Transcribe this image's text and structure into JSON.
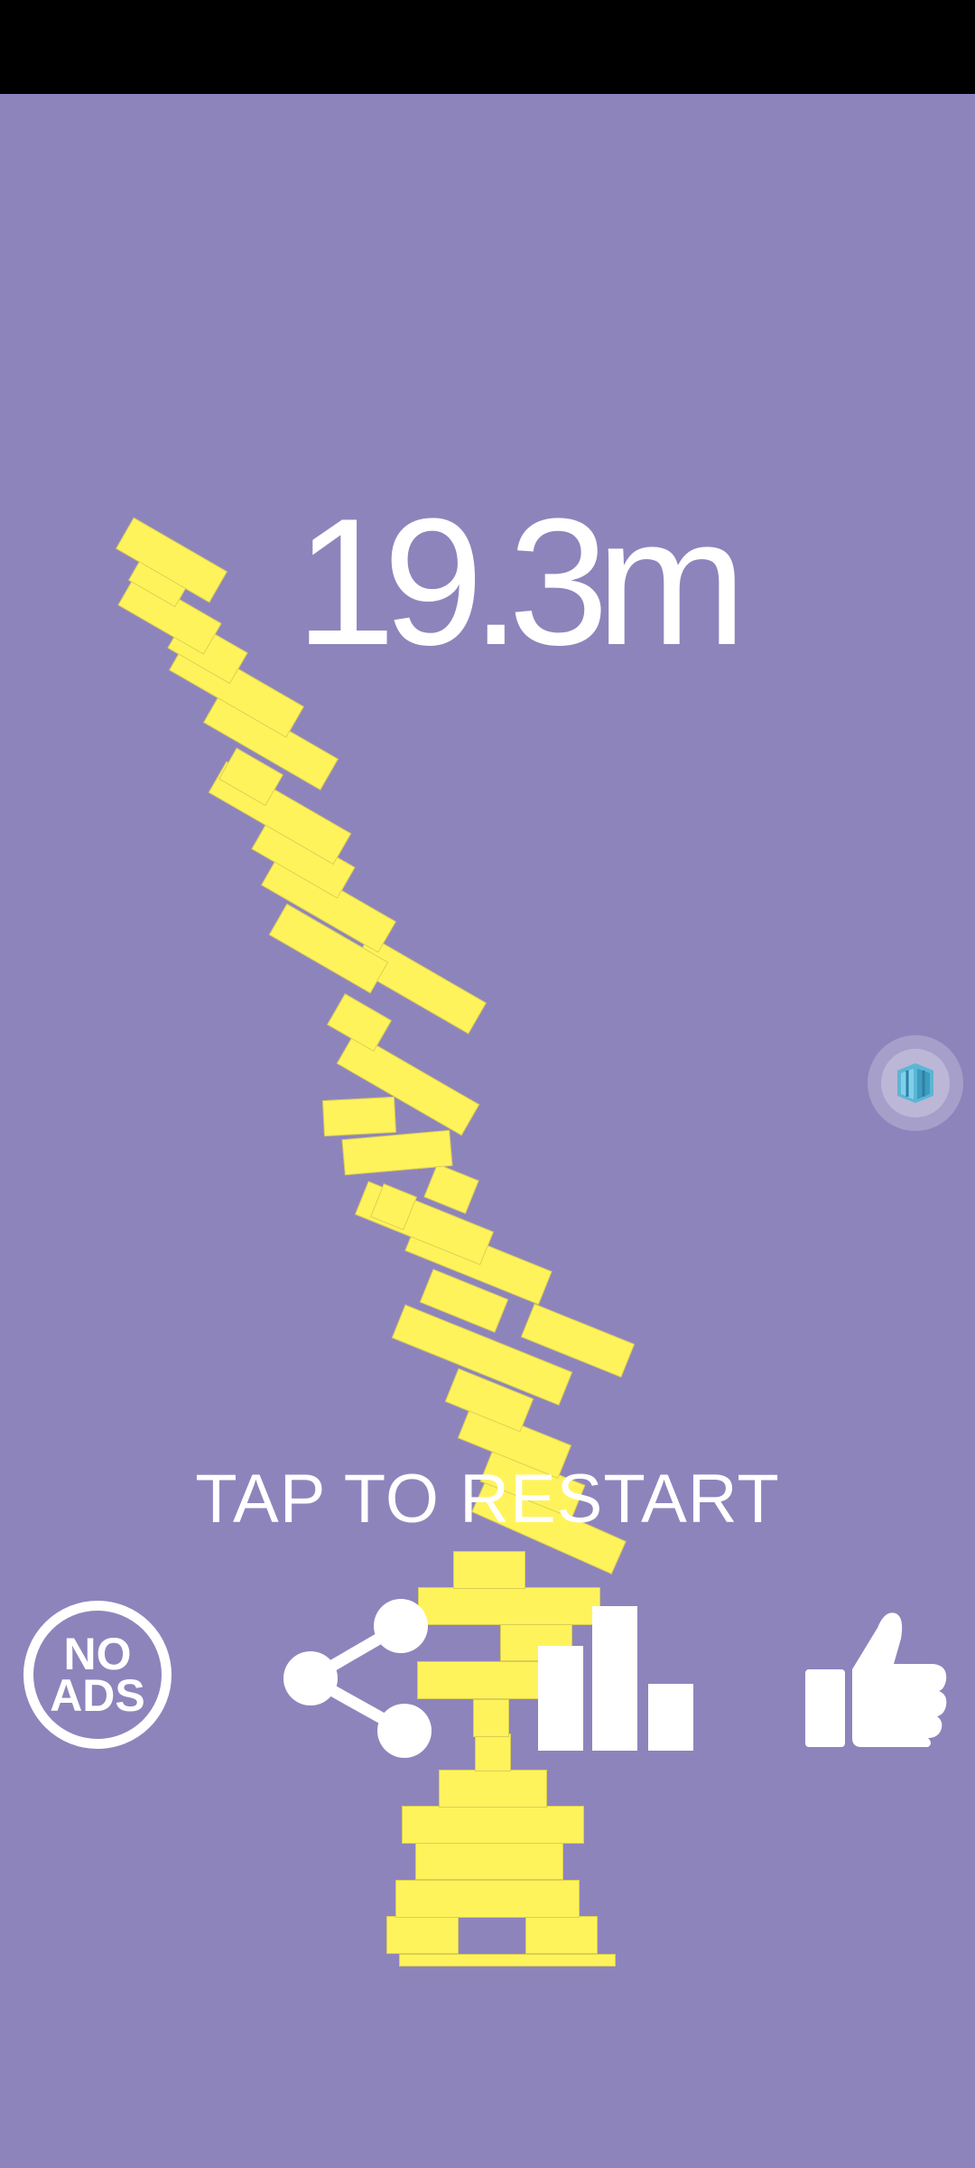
{
  "game": {
    "score": "19.3m",
    "restart_prompt": "TAP TO RESTART"
  },
  "buttons": {
    "no_ads_line1": "NO",
    "no_ads_line2": "ADS",
    "share_icon": "share-icon",
    "leaderboard_icon": "bar-chart-icon",
    "like_icon": "thumbs-up-icon",
    "camera_icon": "cube-camera-icon"
  },
  "colors": {
    "background": "#8e84bc",
    "block": "#fff35c",
    "text": "#ffffff",
    "status_bar": "#000000"
  }
}
